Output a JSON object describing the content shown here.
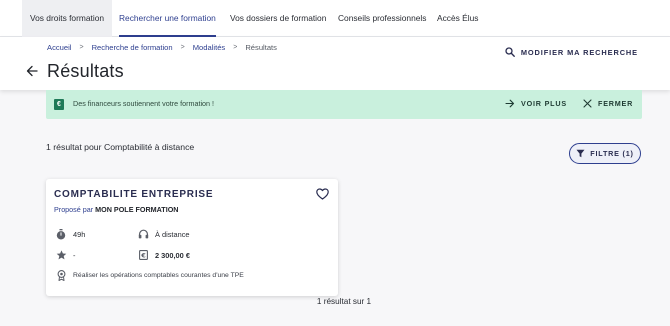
{
  "nav": {
    "tabs": [
      {
        "label": "Vos droits formation"
      },
      {
        "label": "Rechercher une formation"
      },
      {
        "label": "Vos dossiers de formation"
      },
      {
        "label": "Conseils professionnels"
      },
      {
        "label": "Accès Élus"
      }
    ],
    "active": "Rechercher une formation"
  },
  "breadcrumb": {
    "items": [
      "Accueil",
      "Recherche de formation",
      "Modalités"
    ],
    "current": "Résultats"
  },
  "page_title": "Résultats",
  "modify_search_label": "MODIFIER MA RECHERCHE",
  "banner": {
    "message": "Des financeurs soutiennent votre formation !",
    "see_more_label": "VOIR PLUS",
    "close_label": "FERMER",
    "color": "#c9f0dd"
  },
  "results": {
    "count_text": "1 résultat pour Comptabilité à distance",
    "filter_label": "FILTRE (1)",
    "pagination_text": "1 résultat sur 1"
  },
  "card": {
    "title": "COMPTABILITE ENTREPRISE",
    "provider_prefix": "Proposé par",
    "provider_name": "MON POLE FORMATION",
    "duration": "49h",
    "modality": "À distance",
    "rating": "-",
    "price": "2 300,00 €",
    "objective": "Réaliser les opérations comptables courantes d'une TPE"
  },
  "colors": {
    "accent": "#2e3f8f",
    "banner_icon": "#1f7a58"
  },
  "icons": [
    "back-arrow-icon",
    "search-icon",
    "euro-icon",
    "arrow-right-icon",
    "close-icon",
    "filter-icon",
    "heart-icon",
    "stopwatch-icon",
    "headphones-icon",
    "star-icon",
    "price-tag-icon",
    "medal-icon"
  ]
}
